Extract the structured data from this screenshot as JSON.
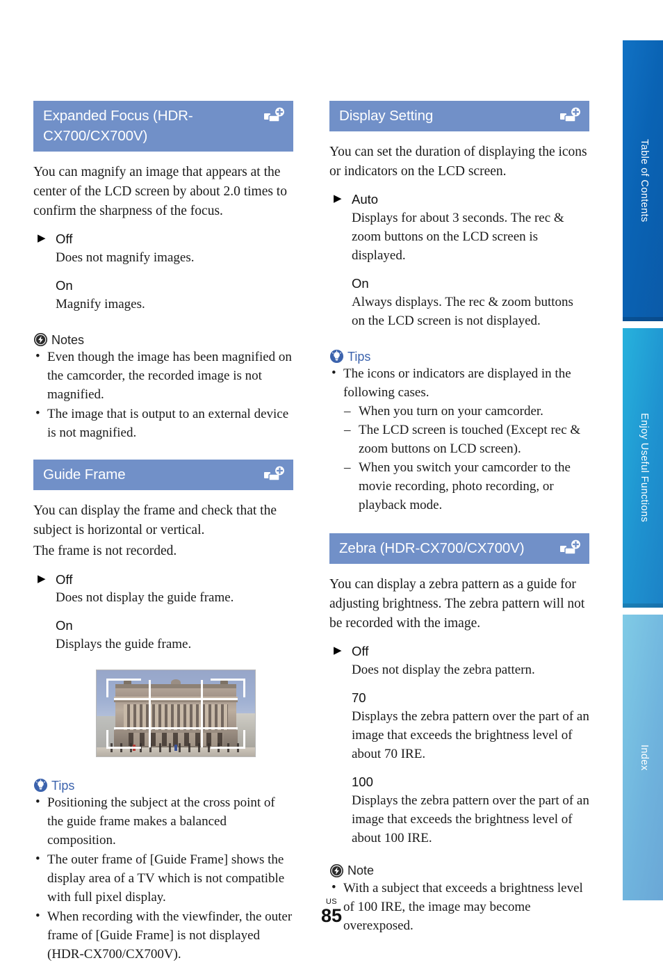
{
  "page": {
    "footer_region": "US",
    "footer_number": "85"
  },
  "colors": {
    "section_header_bg": "#7190c8",
    "tips_accent": "#3c63ad",
    "tab_toc": "#0a63b4",
    "tab_enjoy": "#1f93d0",
    "tab_index": "#6fb3dd"
  },
  "side_tabs": [
    {
      "label": "Table of Contents"
    },
    {
      "label": "Enjoy Useful Functions"
    },
    {
      "label": "Index"
    }
  ],
  "left_column": {
    "section_expanded_focus": {
      "title": "Expanded Focus (HDR-CX700/CX700V)",
      "icon": "add-to-menu-icon",
      "intro": "You can magnify an image that appears at the center of the LCD screen by about 2.0 times to confirm the sharpness of the focus.",
      "options": [
        {
          "marker": "▶",
          "name": "Off",
          "desc": "Does not magnify images."
        },
        {
          "marker": "",
          "name": "On",
          "desc": "Magnify images."
        }
      ],
      "notes": {
        "label": "Notes",
        "icon": "note-bolt-icon",
        "items": [
          "Even though the image has been magnified on the camcorder, the recorded image is not magnified.",
          "The image that is output to an external device is not magnified."
        ]
      }
    },
    "section_guide_frame": {
      "title": "Guide Frame",
      "icon": "add-to-menu-icon",
      "intro": "You can display the frame and check that the subject is horizontal or vertical.\nThe frame is not recorded.",
      "intro_line1": "You can display the frame and check that the subject is horizontal or vertical.",
      "intro_line2": "The frame is not recorded.",
      "options": [
        {
          "marker": "▶",
          "name": "Off",
          "desc": "Does not display the guide frame."
        },
        {
          "marker": "",
          "name": "On",
          "desc": "Displays the guide frame."
        }
      ],
      "figure": {
        "alt": "Photograph of a neoclassical building with the white guide frame grid overlaid"
      },
      "tips": {
        "label": "Tips",
        "icon": "tip-bulb-icon",
        "items": [
          "Positioning the subject at the cross point of the guide frame makes a balanced composition.",
          "The outer frame of [Guide Frame] shows the display area of a TV which is not compatible with full pixel display.",
          "When recording with the viewfinder, the outer frame of [Guide Frame] is not displayed (HDR-CX700/CX700V)."
        ]
      }
    }
  },
  "right_column": {
    "section_display_setting": {
      "title": "Display Setting",
      "icon": "add-to-menu-icon",
      "intro": "You can set the duration of displaying the icons or indicators on the LCD screen.",
      "options": [
        {
          "marker": "▶",
          "name": "Auto",
          "desc": "Displays for about 3 seconds. The rec & zoom buttons on the LCD screen is displayed."
        },
        {
          "marker": "",
          "name": "On",
          "desc": "Always displays. The rec & zoom buttons on the LCD screen is not displayed."
        }
      ],
      "tips": {
        "label": "Tips",
        "icon": "tip-bulb-icon",
        "items": [
          "The icons or indicators are displayed in the following cases."
        ],
        "sub_items": [
          "When you turn on your camcorder.",
          "The LCD screen is touched (Except rec & zoom buttons on LCD screen).",
          "When you switch your camcorder to the movie recording, photo recording, or playback mode."
        ]
      }
    },
    "section_zebra": {
      "title": "Zebra (HDR-CX700/CX700V)",
      "icon": "add-to-menu-icon",
      "intro": "You can display a zebra pattern as a guide for adjusting brightness. The zebra pattern will not be recorded with the image.",
      "options": [
        {
          "marker": "▶",
          "name": "Off",
          "desc": "Does not display the zebra pattern."
        },
        {
          "marker": "",
          "name": "70",
          "desc": "Displays the zebra pattern over the part of an image that exceeds the brightness level of about 70 IRE."
        },
        {
          "marker": "",
          "name": "100",
          "desc": "Displays the zebra pattern over the part of an image that exceeds the brightness level of about 100 IRE."
        }
      ],
      "note": {
        "label": "Note",
        "icon": "note-bolt-icon",
        "items": [
          "With a subject that exceeds a brightness level of 100 IRE, the image may become overexposed."
        ]
      }
    }
  }
}
